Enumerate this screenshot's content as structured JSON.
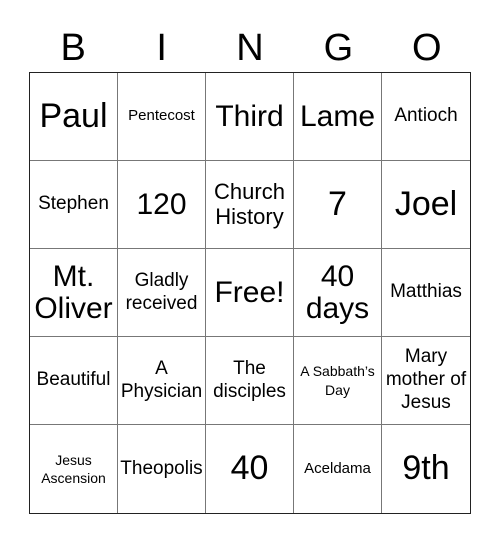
{
  "header": {
    "letters": [
      "B",
      "I",
      "N",
      "G",
      "O"
    ]
  },
  "cells": [
    [
      "Paul",
      "Pentecost",
      "Third",
      "Lame",
      "Antioch"
    ],
    [
      "Stephen",
      "120",
      "Church History",
      "7",
      "Joel"
    ],
    [
      "Mt. Oliver",
      "Gladly received",
      "Free!",
      "40 days",
      "Matthias"
    ],
    [
      "Beautiful",
      "A Physician",
      "The disciples",
      "A Sabbath’s Day",
      "Mary mother of Jesus"
    ],
    [
      "Jesus Ascension",
      "Theopolis",
      "40",
      "Aceldama",
      "9th"
    ]
  ]
}
